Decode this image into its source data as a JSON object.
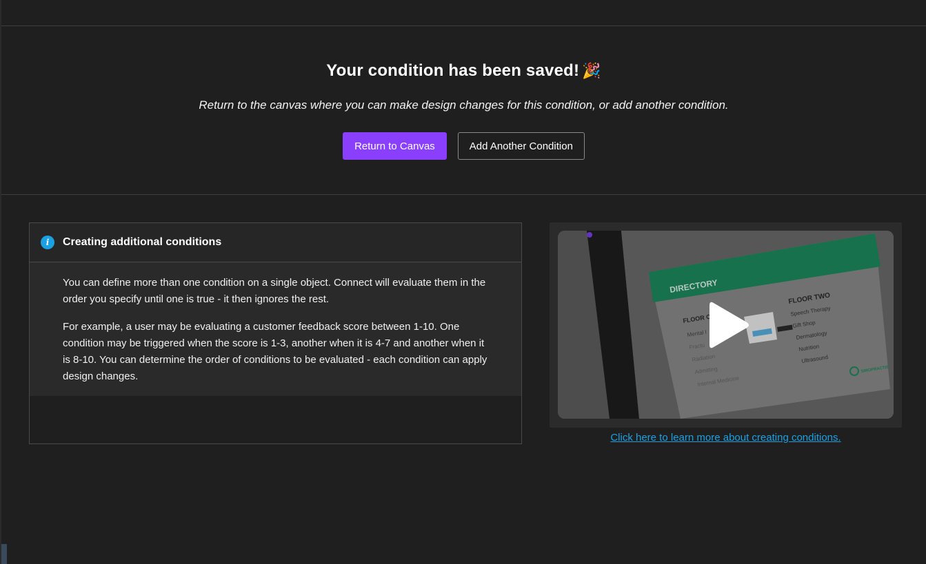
{
  "hero": {
    "title": "Your condition has been saved!",
    "emoji": "🎉",
    "subtitle": "Return to the canvas where you can make design changes for this condition, or add another condition.",
    "primary_button": "Return to Canvas",
    "secondary_button": "Add Another Condition",
    "accent_color": "#8a3ffc"
  },
  "info": {
    "icon": "info-icon",
    "title": "Creating additional conditions",
    "paragraphs": [
      "You can define more than one condition on a single object. Connect will evaluate them in the order you specify until one is true - it then ignores the rest.",
      "For example, a user may be evaluating a customer feedback score between 1-10. One condition may be triggered when the score is 1-3, another when it is 4-7 and another when it is 8-10. You can determine the order of conditions to be evaluated - each condition can apply design changes."
    ]
  },
  "video": {
    "play_icon": "play-icon",
    "link_text": "Click here to learn more about creating conditions.",
    "link_color": "#1ba1e2",
    "thumbnail": {
      "directory_label": "DIRECTORY",
      "floor_one_label": "FLOOR O",
      "floor_two_label": "FLOOR TWO",
      "floor_one_items": [
        "Mental I",
        "Fractu",
        "Radiation",
        "Admitting",
        "Internal Medicine"
      ],
      "floor_two_items": [
        "Speech Therapy",
        "Gift Shop",
        "Dermatology",
        "Nutrition",
        "Ultrasound"
      ],
      "brand": "SIROPRACTIS",
      "banner_color": "#1e8a5e"
    }
  }
}
